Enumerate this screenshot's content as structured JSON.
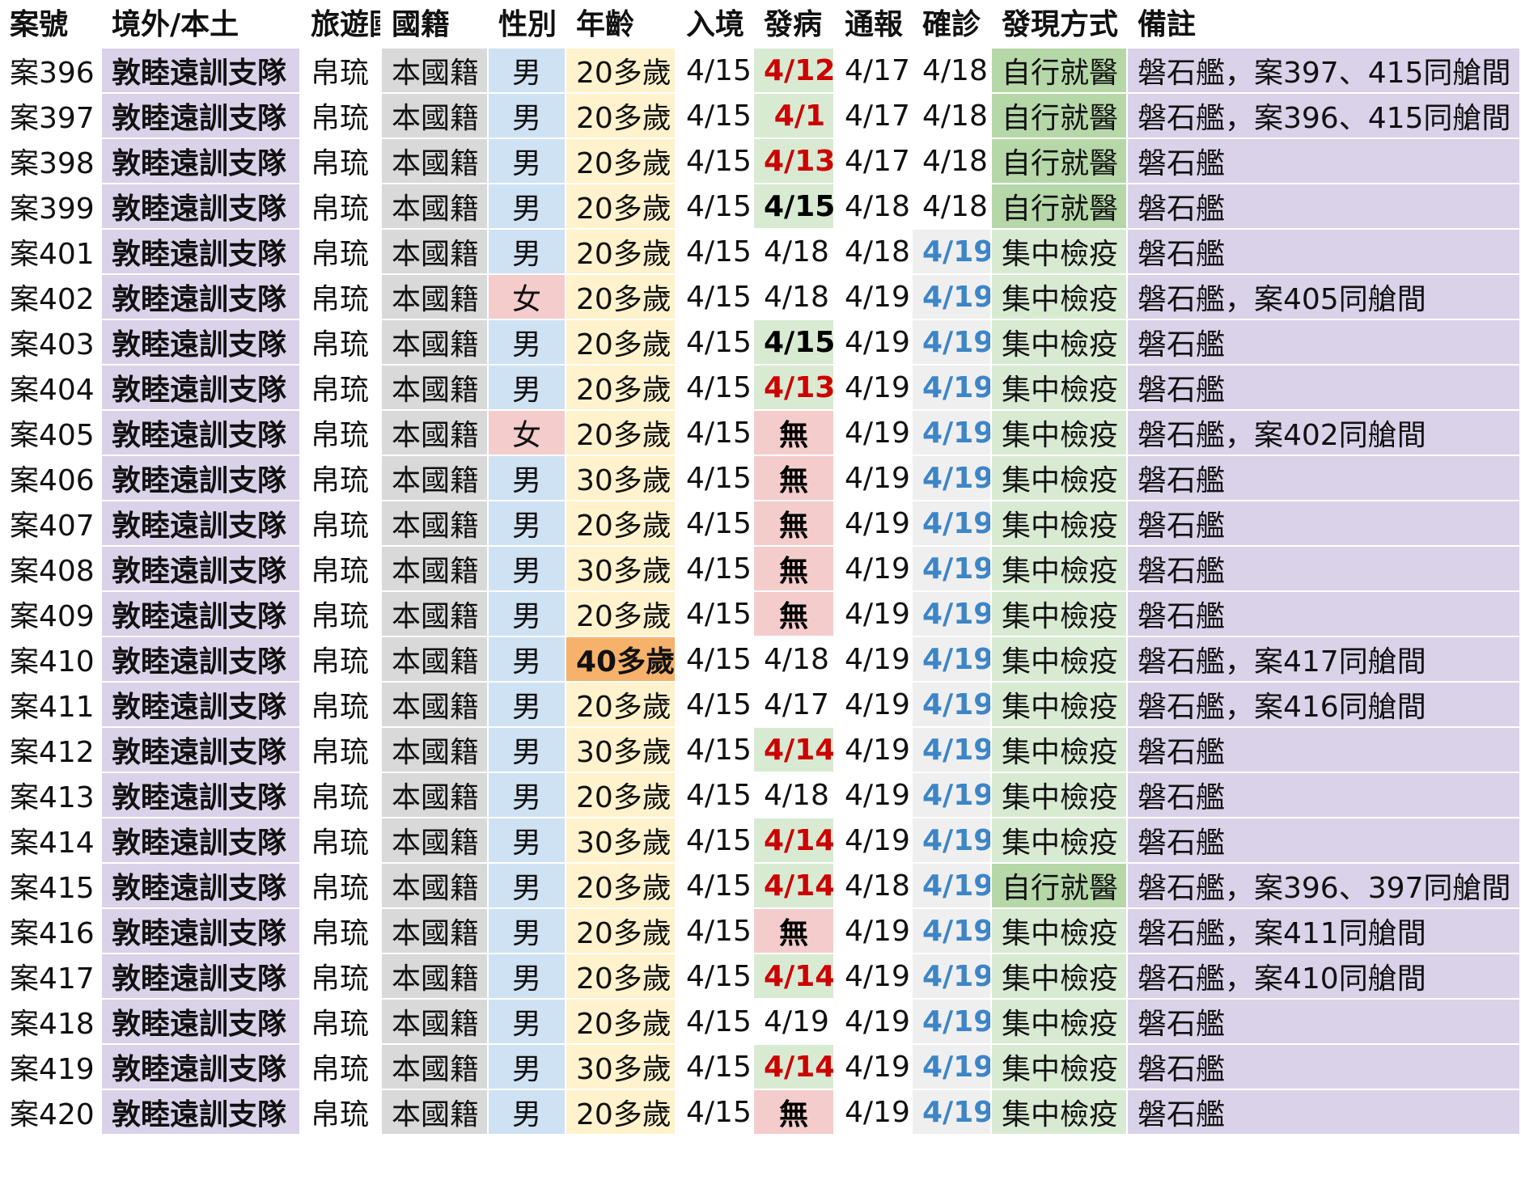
{
  "headers": [
    "案號",
    "境外/本土",
    "旅遊國",
    "國籍",
    "性別",
    "年齡",
    "入境",
    "發病",
    "通報",
    "確診",
    "發現方式",
    "備註"
  ],
  "rows": [
    {
      "case": "案396",
      "origin": "敦睦遠訓支隊",
      "travel": "帛琉",
      "nationality": "本國籍",
      "sex": "男",
      "age": "20多歲",
      "entry": "4/15",
      "onset": "4/12",
      "onset_style": "red",
      "notify": "4/17",
      "confirm": "4/18",
      "confirm_style": "",
      "discovery": "自行就醫",
      "discovery_style": "self",
      "note": "磐石艦，案397、415同艙間"
    },
    {
      "case": "案397",
      "origin": "敦睦遠訓支隊",
      "travel": "帛琉",
      "nationality": "本國籍",
      "sex": "男",
      "age": "20多歲",
      "entry": "4/15",
      "onset": "4/1",
      "onset_style": "red",
      "notify": "4/17",
      "confirm": "4/18",
      "confirm_style": "",
      "discovery": "自行就醫",
      "discovery_style": "self",
      "note": "磐石艦，案396、415同艙間"
    },
    {
      "case": "案398",
      "origin": "敦睦遠訓支隊",
      "travel": "帛琉",
      "nationality": "本國籍",
      "sex": "男",
      "age": "20多歲",
      "entry": "4/15",
      "onset": "4/13",
      "onset_style": "red",
      "notify": "4/17",
      "confirm": "4/18",
      "confirm_style": "",
      "discovery": "自行就醫",
      "discovery_style": "self",
      "note": "磐石艦"
    },
    {
      "case": "案399",
      "origin": "敦睦遠訓支隊",
      "travel": "帛琉",
      "nationality": "本國籍",
      "sex": "男",
      "age": "20多歲",
      "entry": "4/15",
      "onset": "4/15",
      "onset_style": "bold",
      "notify": "4/18",
      "confirm": "4/18",
      "confirm_style": "",
      "discovery": "自行就醫",
      "discovery_style": "self",
      "note": "磐石艦"
    },
    {
      "case": "案401",
      "origin": "敦睦遠訓支隊",
      "travel": "帛琉",
      "nationality": "本國籍",
      "sex": "男",
      "age": "20多歲",
      "entry": "4/15",
      "onset": "4/18",
      "onset_style": "",
      "notify": "4/18",
      "confirm": "4/19",
      "confirm_style": "blue",
      "discovery": "集中檢疫",
      "discovery_style": "quar",
      "note": "磐石艦"
    },
    {
      "case": "案402",
      "origin": "敦睦遠訓支隊",
      "travel": "帛琉",
      "nationality": "本國籍",
      "sex": "女",
      "age": "20多歲",
      "entry": "4/15",
      "onset": "4/18",
      "onset_style": "",
      "notify": "4/19",
      "confirm": "4/19",
      "confirm_style": "blue",
      "discovery": "集中檢疫",
      "discovery_style": "quar",
      "note": "磐石艦，案405同艙間"
    },
    {
      "case": "案403",
      "origin": "敦睦遠訓支隊",
      "travel": "帛琉",
      "nationality": "本國籍",
      "sex": "男",
      "age": "20多歲",
      "entry": "4/15",
      "onset": "4/15",
      "onset_style": "bold",
      "notify": "4/19",
      "confirm": "4/19",
      "confirm_style": "blue",
      "discovery": "集中檢疫",
      "discovery_style": "quar",
      "note": "磐石艦"
    },
    {
      "case": "案404",
      "origin": "敦睦遠訓支隊",
      "travel": "帛琉",
      "nationality": "本國籍",
      "sex": "男",
      "age": "20多歲",
      "entry": "4/15",
      "onset": "4/13",
      "onset_style": "red",
      "notify": "4/19",
      "confirm": "4/19",
      "confirm_style": "blue",
      "discovery": "集中檢疫",
      "discovery_style": "quar",
      "note": "磐石艦"
    },
    {
      "case": "案405",
      "origin": "敦睦遠訓支隊",
      "travel": "帛琉",
      "nationality": "本國籍",
      "sex": "女",
      "age": "20多歲",
      "entry": "4/15",
      "onset": "無",
      "onset_style": "none",
      "notify": "4/19",
      "confirm": "4/19",
      "confirm_style": "blue",
      "discovery": "集中檢疫",
      "discovery_style": "quar",
      "note": "磐石艦，案402同艙間"
    },
    {
      "case": "案406",
      "origin": "敦睦遠訓支隊",
      "travel": "帛琉",
      "nationality": "本國籍",
      "sex": "男",
      "age": "30多歲",
      "entry": "4/15",
      "onset": "無",
      "onset_style": "none",
      "notify": "4/19",
      "confirm": "4/19",
      "confirm_style": "blue",
      "discovery": "集中檢疫",
      "discovery_style": "quar",
      "note": "磐石艦"
    },
    {
      "case": "案407",
      "origin": "敦睦遠訓支隊",
      "travel": "帛琉",
      "nationality": "本國籍",
      "sex": "男",
      "age": "20多歲",
      "entry": "4/15",
      "onset": "無",
      "onset_style": "none",
      "notify": "4/19",
      "confirm": "4/19",
      "confirm_style": "blue",
      "discovery": "集中檢疫",
      "discovery_style": "quar",
      "note": "磐石艦"
    },
    {
      "case": "案408",
      "origin": "敦睦遠訓支隊",
      "travel": "帛琉",
      "nationality": "本國籍",
      "sex": "男",
      "age": "30多歲",
      "entry": "4/15",
      "onset": "無",
      "onset_style": "none",
      "notify": "4/19",
      "confirm": "4/19",
      "confirm_style": "blue",
      "discovery": "集中檢疫",
      "discovery_style": "quar",
      "note": "磐石艦"
    },
    {
      "case": "案409",
      "origin": "敦睦遠訓支隊",
      "travel": "帛琉",
      "nationality": "本國籍",
      "sex": "男",
      "age": "20多歲",
      "entry": "4/15",
      "onset": "無",
      "onset_style": "none",
      "notify": "4/19",
      "confirm": "4/19",
      "confirm_style": "blue",
      "discovery": "集中檢疫",
      "discovery_style": "quar",
      "note": "磐石艦"
    },
    {
      "case": "案410",
      "origin": "敦睦遠訓支隊",
      "travel": "帛琉",
      "nationality": "本國籍",
      "sex": "男",
      "age": "40多歲",
      "age_style": "hi",
      "entry": "4/15",
      "onset": "4/18",
      "onset_style": "",
      "notify": "4/19",
      "confirm": "4/19",
      "confirm_style": "blue",
      "discovery": "集中檢疫",
      "discovery_style": "quar",
      "note": "磐石艦，案417同艙間"
    },
    {
      "case": "案411",
      "origin": "敦睦遠訓支隊",
      "travel": "帛琉",
      "nationality": "本國籍",
      "sex": "男",
      "age": "20多歲",
      "entry": "4/15",
      "onset": "4/17",
      "onset_style": "",
      "notify": "4/19",
      "confirm": "4/19",
      "confirm_style": "blue",
      "discovery": "集中檢疫",
      "discovery_style": "quar",
      "note": "磐石艦，案416同艙間"
    },
    {
      "case": "案412",
      "origin": "敦睦遠訓支隊",
      "travel": "帛琉",
      "nationality": "本國籍",
      "sex": "男",
      "age": "30多歲",
      "entry": "4/15",
      "onset": "4/14",
      "onset_style": "red",
      "notify": "4/19",
      "confirm": "4/19",
      "confirm_style": "blue",
      "discovery": "集中檢疫",
      "discovery_style": "quar",
      "note": "磐石艦"
    },
    {
      "case": "案413",
      "origin": "敦睦遠訓支隊",
      "travel": "帛琉",
      "nationality": "本國籍",
      "sex": "男",
      "age": "20多歲",
      "entry": "4/15",
      "onset": "4/18",
      "onset_style": "",
      "notify": "4/19",
      "confirm": "4/19",
      "confirm_style": "blue",
      "discovery": "集中檢疫",
      "discovery_style": "quar",
      "note": "磐石艦"
    },
    {
      "case": "案414",
      "origin": "敦睦遠訓支隊",
      "travel": "帛琉",
      "nationality": "本國籍",
      "sex": "男",
      "age": "30多歲",
      "entry": "4/15",
      "onset": "4/14",
      "onset_style": "red",
      "notify": "4/19",
      "confirm": "4/19",
      "confirm_style": "blue",
      "discovery": "集中檢疫",
      "discovery_style": "quar",
      "note": "磐石艦"
    },
    {
      "case": "案415",
      "origin": "敦睦遠訓支隊",
      "travel": "帛琉",
      "nationality": "本國籍",
      "sex": "男",
      "age": "20多歲",
      "entry": "4/15",
      "onset": "4/14",
      "onset_style": "red",
      "notify": "4/18",
      "confirm": "4/19",
      "confirm_style": "blue",
      "discovery": "自行就醫",
      "discovery_style": "self",
      "note": "磐石艦，案396、397同艙間"
    },
    {
      "case": "案416",
      "origin": "敦睦遠訓支隊",
      "travel": "帛琉",
      "nationality": "本國籍",
      "sex": "男",
      "age": "20多歲",
      "entry": "4/15",
      "onset": "無",
      "onset_style": "none",
      "notify": "4/19",
      "confirm": "4/19",
      "confirm_style": "blue",
      "discovery": "集中檢疫",
      "discovery_style": "quar",
      "note": "磐石艦，案411同艙間"
    },
    {
      "case": "案417",
      "origin": "敦睦遠訓支隊",
      "travel": "帛琉",
      "nationality": "本國籍",
      "sex": "男",
      "age": "20多歲",
      "entry": "4/15",
      "onset": "4/14",
      "onset_style": "red",
      "notify": "4/19",
      "confirm": "4/19",
      "confirm_style": "blue",
      "discovery": "集中檢疫",
      "discovery_style": "quar",
      "note": "磐石艦，案410同艙間"
    },
    {
      "case": "案418",
      "origin": "敦睦遠訓支隊",
      "travel": "帛琉",
      "nationality": "本國籍",
      "sex": "男",
      "age": "20多歲",
      "entry": "4/15",
      "onset": "4/19",
      "onset_style": "",
      "notify": "4/19",
      "confirm": "4/19",
      "confirm_style": "blue",
      "discovery": "集中檢疫",
      "discovery_style": "quar",
      "note": "磐石艦"
    },
    {
      "case": "案419",
      "origin": "敦睦遠訓支隊",
      "travel": "帛琉",
      "nationality": "本國籍",
      "sex": "男",
      "age": "30多歲",
      "entry": "4/15",
      "onset": "4/14",
      "onset_style": "red",
      "notify": "4/19",
      "confirm": "4/19",
      "confirm_style": "blue",
      "discovery": "集中檢疫",
      "discovery_style": "quar",
      "note": "磐石艦"
    },
    {
      "case": "案420",
      "origin": "敦睦遠訓支隊",
      "travel": "帛琉",
      "nationality": "本國籍",
      "sex": "男",
      "age": "20多歲",
      "entry": "4/15",
      "onset": "無",
      "onset_style": "none",
      "notify": "4/19",
      "confirm": "4/19",
      "confirm_style": "blue",
      "discovery": "集中檢疫",
      "discovery_style": "quar",
      "note": "磐石艦"
    }
  ]
}
